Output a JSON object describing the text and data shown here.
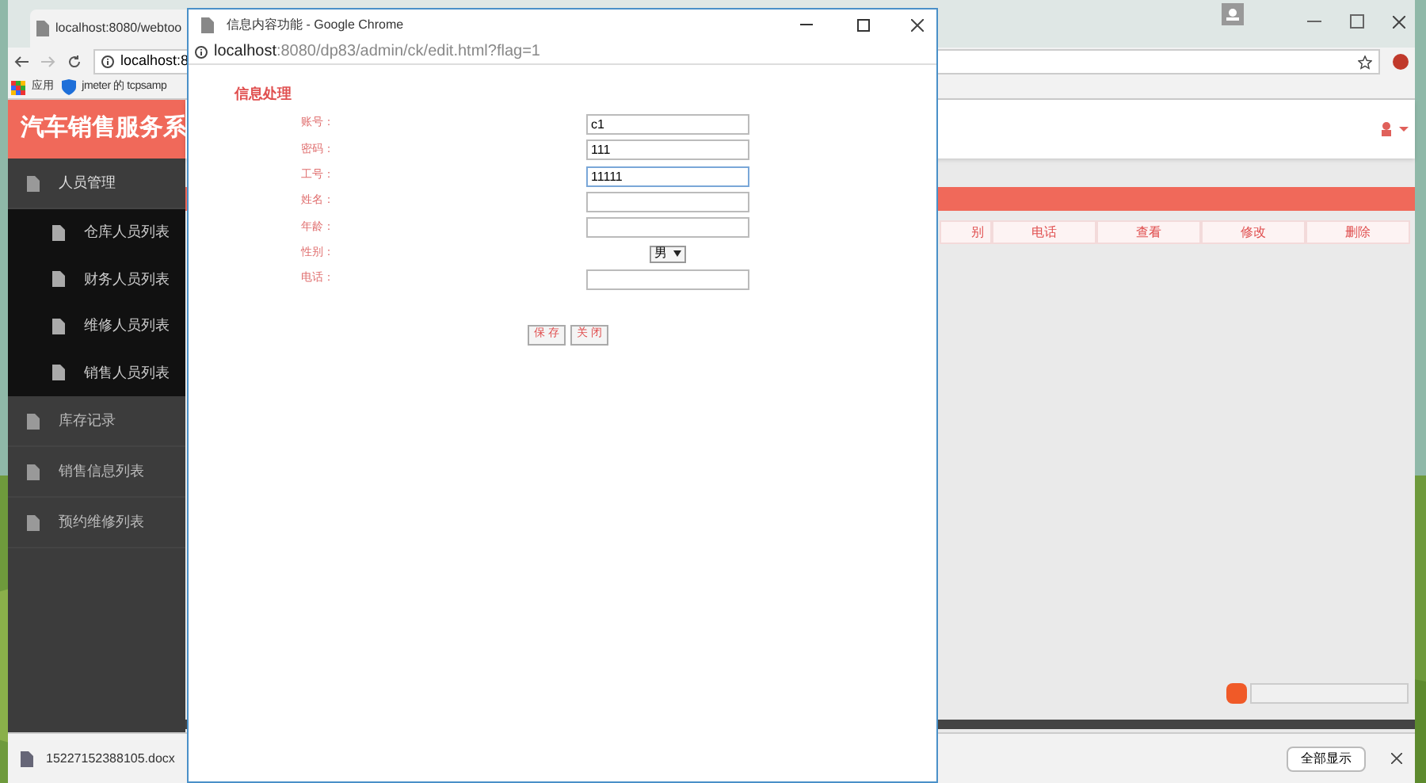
{
  "main_window": {
    "tab_title": "localhost:8080/webtoo",
    "address": "localhost:8",
    "bookmarks": [
      {
        "label": "应用",
        "kind": "apps"
      },
      {
        "label": "jmeter 的 tcpsamp",
        "kind": "shield"
      }
    ],
    "app_title": "汽车销售服务系",
    "sidebar": [
      {
        "label": "人员管理",
        "expanded": true,
        "children": [
          {
            "label": "仓库人员列表"
          },
          {
            "label": "财务人员列表"
          },
          {
            "label": "维修人员列表"
          },
          {
            "label": "销售人员列表"
          }
        ]
      },
      {
        "label": "库存记录",
        "expanded": false
      },
      {
        "label": "销售信息列表",
        "expanded": false
      },
      {
        "label": "预约维修列表",
        "expanded": false
      }
    ],
    "table_columns": [
      "别",
      "电话",
      "查看",
      "修改",
      "删除"
    ],
    "download": {
      "file": "15227152388105.docx",
      "show_all": "全部显示"
    }
  },
  "popup": {
    "title": "信息内容功能 - Google Chrome",
    "url_host": "localhost",
    "url_rest": ":8080/dp83/admin/ck/edit.html?flag=1",
    "heading": "信息处理",
    "fields": [
      {
        "label": "账号：",
        "kind": "text",
        "value": "c1",
        "focused": false
      },
      {
        "label": "密码：",
        "kind": "text",
        "value": "111",
        "focused": false
      },
      {
        "label": "工号：",
        "kind": "text",
        "value": "11111",
        "focused": true
      },
      {
        "label": "姓名：",
        "kind": "text",
        "focused": false
      },
      {
        "label": "年龄：",
        "kind": "text",
        "focused": false
      },
      {
        "label": "性别：",
        "kind": "select",
        "value": "男"
      },
      {
        "label": "电话：",
        "kind": "text",
        "focused": false
      }
    ],
    "buttons": [
      "保 存",
      "关 闭"
    ]
  }
}
